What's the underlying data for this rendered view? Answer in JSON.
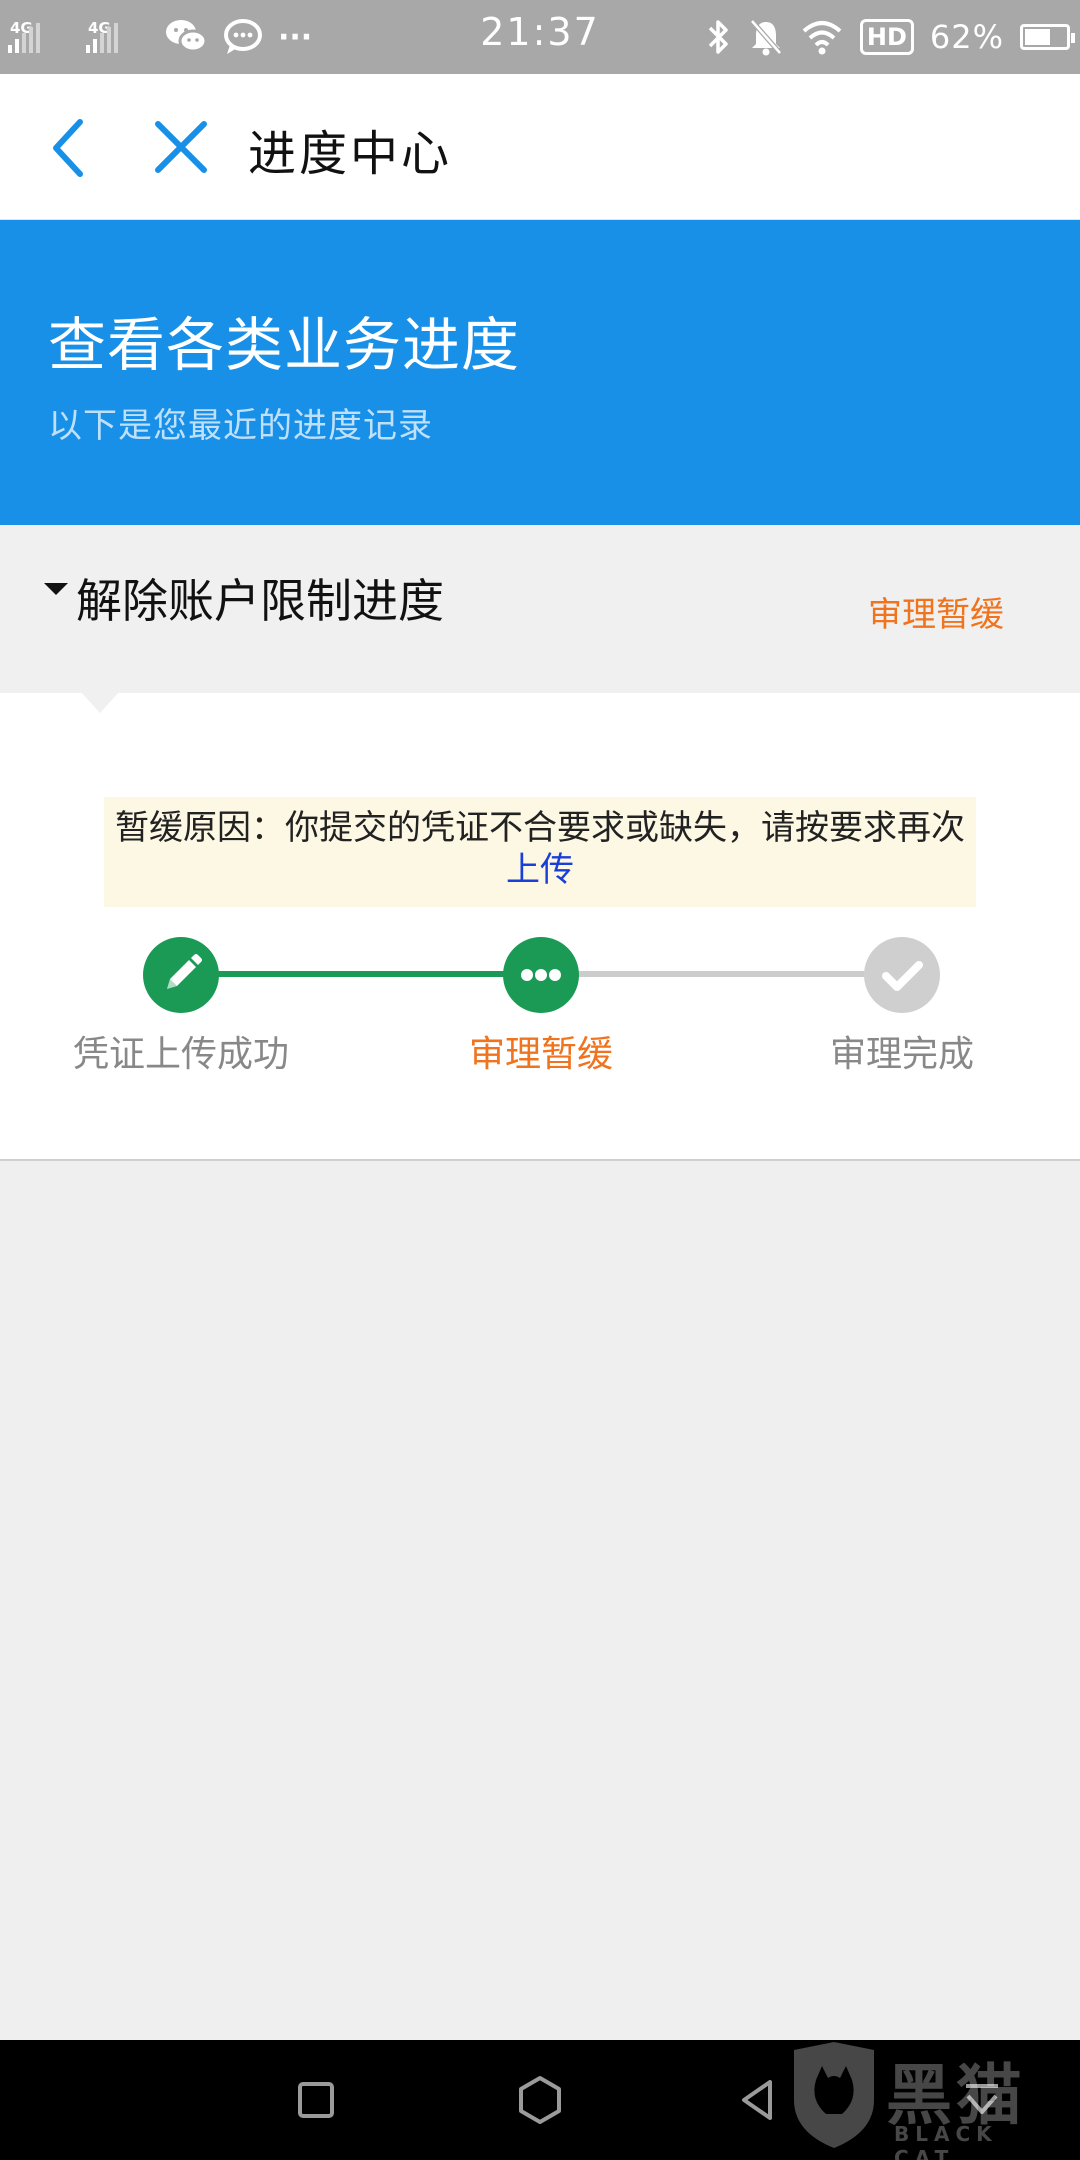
{
  "status_bar": {
    "signal_1": "4G",
    "signal_2": "4G",
    "more_dots": "···",
    "time": "21:37",
    "hd_badge": "HD",
    "battery": "62%"
  },
  "header": {
    "title": "进度中心"
  },
  "banner": {
    "title": "查看各类业务进度",
    "subtitle": "以下是您最近的进度记录"
  },
  "section": {
    "title": "解除账户限制进度",
    "status": "审理暂缓"
  },
  "notice": {
    "text": "暂缓原因：你提交的凭证不合要求或缺失，请按要求再次",
    "link_text": "上传"
  },
  "steps": [
    {
      "label": "凭证上传成功",
      "state": "done",
      "icon": "pencil-icon"
    },
    {
      "label": "审理暂缓",
      "state": "current",
      "icon": "dots-icon"
    },
    {
      "label": "审理完成",
      "state": "pending",
      "icon": "check-icon"
    }
  ],
  "watermark": {
    "cn": "黑猫",
    "en": "BLACK CAT"
  },
  "colors": {
    "accent_blue": "#1890e8",
    "step_green": "#1b9a55",
    "status_orange": "#f0731e",
    "link_blue": "#1a3ed8",
    "notice_bg": "#fdf8e4"
  }
}
